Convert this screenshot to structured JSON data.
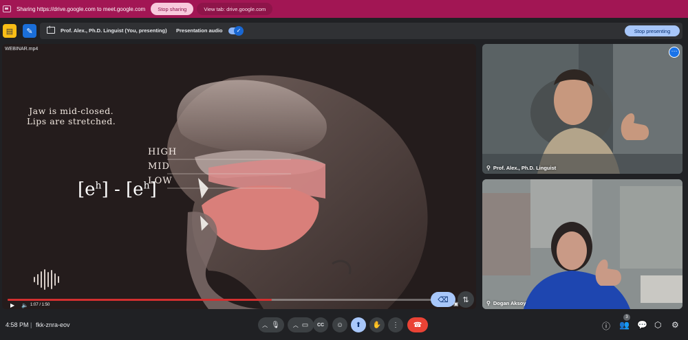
{
  "share_bar": {
    "text": "Sharing https://drive.google.com to meet.google.com",
    "stop_label": "Stop sharing",
    "view_label": "View tab: drive.google.com",
    "color": "#a21654"
  },
  "present_bar": {
    "presenter": "Prof. Alex., Ph.D. Linguist (You, presenting)",
    "audio_label": "Presentation audio",
    "audio_enabled": true,
    "stop_label": "Stop presenting"
  },
  "presentation": {
    "file_title": "WEBINAR.mp4",
    "caption_line1": "Jaw is mid-closed.",
    "caption_line2": "Lips are stretched.",
    "levels": [
      "HIGH",
      "MID",
      "LOW"
    ],
    "phonetic_left": "[e",
    "phonetic_left_sup": "h",
    "phonetic_dash": "] - [e",
    "phonetic_right_sup": "h",
    "phonetic_end": "]",
    "progress": 0.6,
    "time": "1:07 / 1:50"
  },
  "participants": [
    {
      "name": "Prof. Alex., Ph.D. Linguist"
    },
    {
      "name": "Dogan Aksoy"
    }
  ],
  "bottom_bar": {
    "time": "4:58 PM",
    "separator": "|",
    "meeting_code": "fkk-znra-eov",
    "people_count": "3"
  },
  "icons": {
    "pin": "pin-icon",
    "more": "more-options-icon",
    "mic": "microphone-icon",
    "camera": "camera-icon",
    "captions": "captions-icon",
    "emoji": "emoji-icon",
    "present": "present-icon",
    "hand": "raise-hand-icon",
    "end": "end-call-icon"
  }
}
